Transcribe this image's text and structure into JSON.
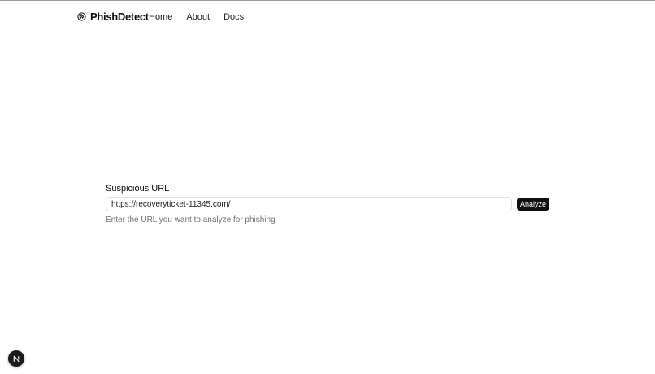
{
  "header": {
    "brand_name": "PhishDetect",
    "brand_icon": "fingerprint-icon",
    "nav": [
      {
        "label": "Home"
      },
      {
        "label": "About"
      },
      {
        "label": "Docs"
      }
    ]
  },
  "form": {
    "label": "Suspicious URL",
    "input_value": "https://recoveryticket-11345.com/",
    "button_label": "Analyze",
    "hint": "Enter the URL you want to analyze for phishing"
  },
  "badge": {
    "icon": "nextjs-logo-icon"
  },
  "colors": {
    "button_bg": "#111111",
    "hint_text": "#737373",
    "badge_bg": "#1b1b1b"
  }
}
